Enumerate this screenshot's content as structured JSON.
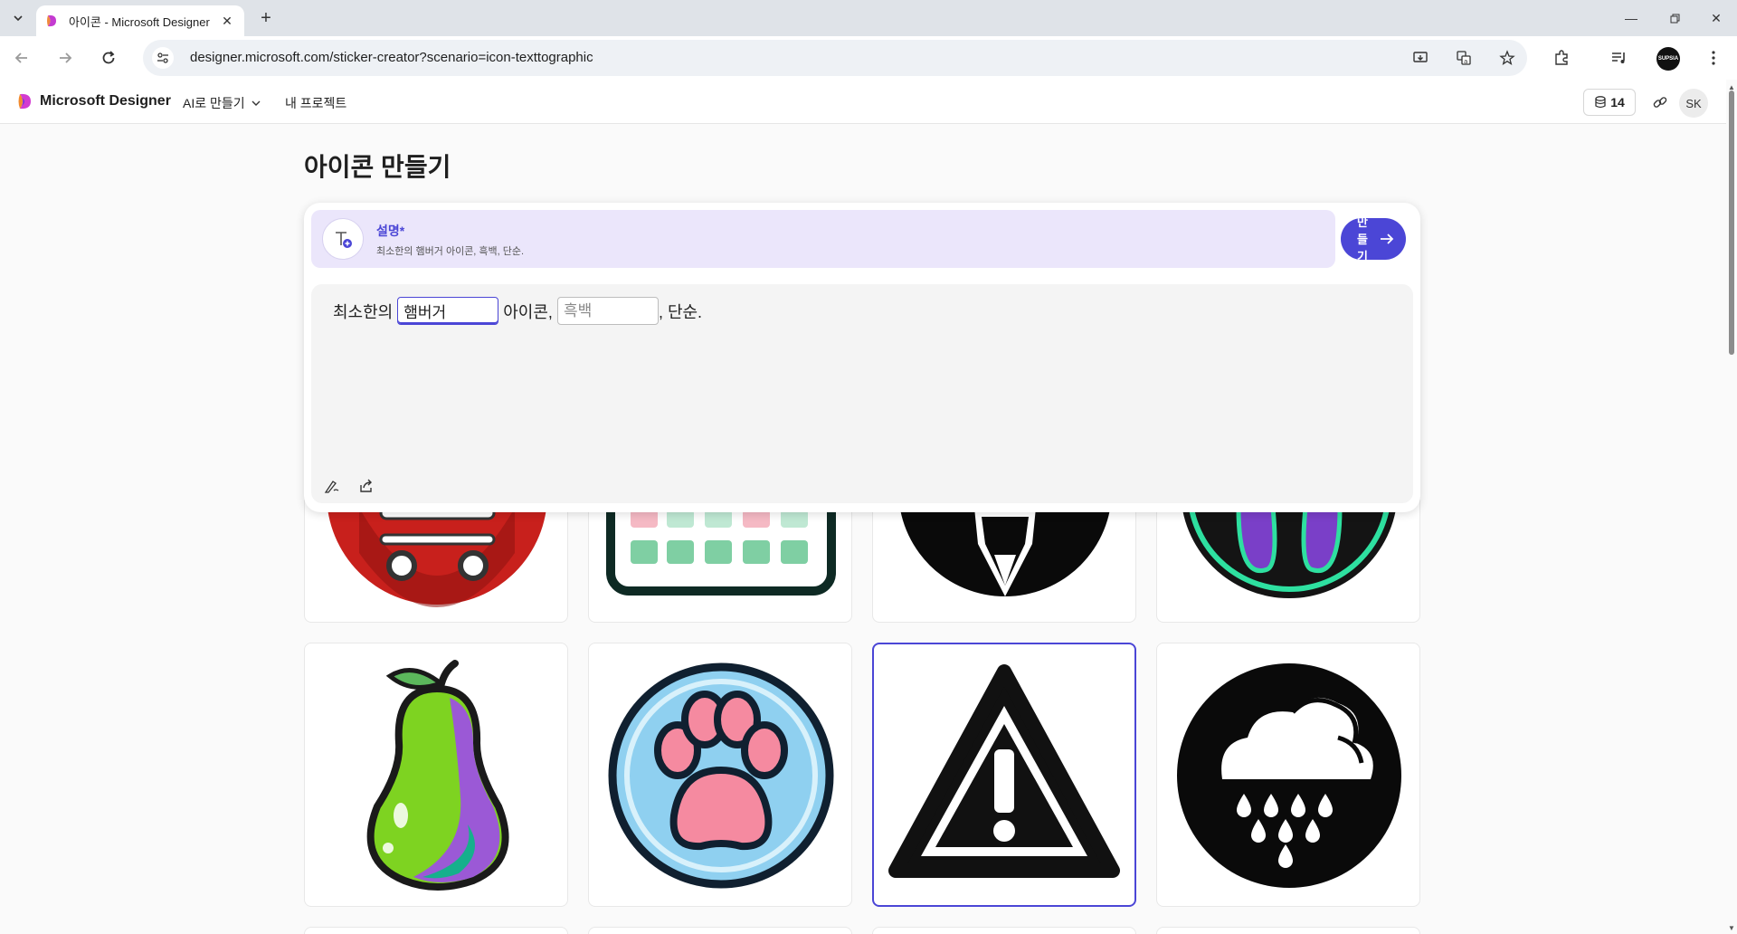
{
  "browser": {
    "tab_title": "아이콘 - Microsoft Designer",
    "url": "designer.microsoft.com/sticker-creator?scenario=icon-texttographic",
    "profile_label": "SUPSIA"
  },
  "app": {
    "brand": "Microsoft Designer",
    "nav": {
      "ai_create": "AI로 만들기",
      "my_projects": "내 프로젝트"
    },
    "credits": "14",
    "avatar_initials": "SK"
  },
  "page": {
    "title": "아이콘 만들기"
  },
  "prompt": {
    "label": "설명*",
    "description": "최소한의 햄버거 아이콘, 흑백, 단순.",
    "create_button_label": "만들기",
    "sentence": {
      "prefix": "최소한의",
      "subject_value": "햄버거",
      "middle": "아이콘,",
      "style_placeholder": "흑백",
      "suffix": ", 단순."
    }
  },
  "gallery": {
    "items": [
      {
        "name": "shopping-cart-icon"
      },
      {
        "name": "calendar-icon"
      },
      {
        "name": "pencil-icon"
      },
      {
        "name": "footprints-icon"
      },
      {
        "name": "pear-icon"
      },
      {
        "name": "paw-icon"
      },
      {
        "name": "warning-icon",
        "selected": true
      },
      {
        "name": "rain-cloud-icon"
      }
    ]
  },
  "colors": {
    "accent": "#4b46d6",
    "description_bg": "#ebe6fb",
    "cart_red": "#c8201c",
    "calendar_green": "#7fcfa3",
    "calendar_pink": "#f5b9c4",
    "footprint_purple": "#7a3fc8",
    "footprint_teal": "#2ee0a0",
    "pear_green": "#7ed321",
    "pear_purple": "#9b59d6",
    "paw_blue": "#8fd0f0",
    "paw_pink": "#f58aa0"
  }
}
